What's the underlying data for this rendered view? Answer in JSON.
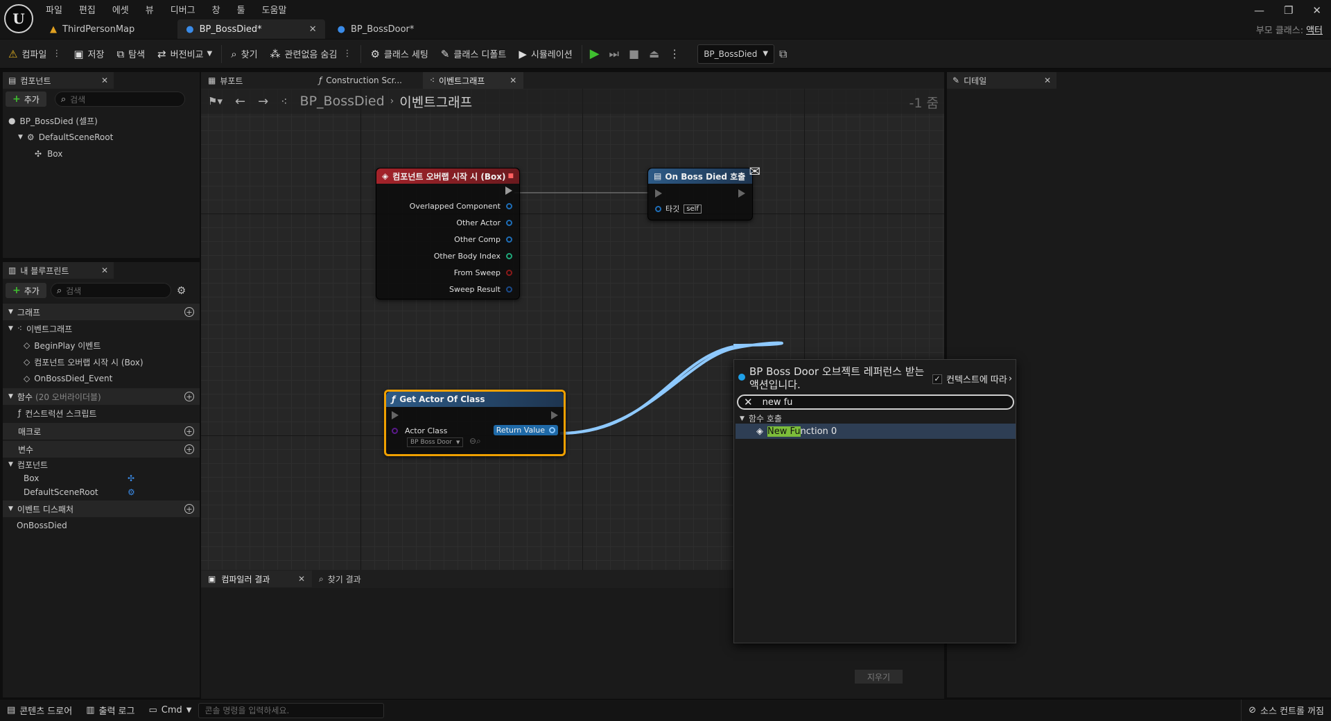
{
  "menu": [
    "파일",
    "편집",
    "에셋",
    "뷰",
    "디버그",
    "창",
    "툴",
    "도움말"
  ],
  "doc_tabs": [
    {
      "label": "ThirdPersonMap"
    },
    {
      "label": "BP_BossDied*"
    },
    {
      "label": "BP_BossDoor*"
    }
  ],
  "parent_class": {
    "label": "부모 클래스:",
    "value": "액터"
  },
  "toolbar": {
    "compile": "컴파일",
    "save": "저장",
    "browse": "탐색",
    "diff": "버전비교",
    "find": "찾기",
    "hide_unrelated": "관련없음 숨김",
    "class_settings": "클래스 세팅",
    "class_defaults": "클래스 디폴트",
    "simulation": "시뮬레이션",
    "debug_object": "BP_BossDied"
  },
  "components_panel": {
    "title": "컴포넌트",
    "add": "추가",
    "search_placeholder": "검색",
    "tree": [
      "BP_BossDied (셀프)",
      "DefaultSceneRoot",
      "Box"
    ]
  },
  "my_blueprint": {
    "title": "내 블루프린트",
    "add": "추가",
    "search_placeholder": "검색",
    "graphs_label": "그래프",
    "event_graph": "이벤트그래프",
    "events": [
      "BeginPlay 이벤트",
      "컴포넌트 오버랩 시작 시 (Box)",
      "OnBossDied_Event"
    ],
    "functions_label": "함수",
    "functions_sub": "(20 오버라이더블)",
    "construction_script": "컨스트럭션 스크립트",
    "macros_label": "매크로",
    "variables_label": "변수",
    "components_label": "컴포넌트",
    "variables": [
      "Box",
      "DefaultSceneRoot"
    ],
    "dispatchers_label": "이벤트 디스패처",
    "dispatchers": [
      "OnBossDied"
    ]
  },
  "editor_tabs": [
    {
      "label": "뷰포트"
    },
    {
      "label": "Construction Scr..."
    },
    {
      "label": "이벤트그래프"
    }
  ],
  "breadcrumb": {
    "root": "BP_BossDied",
    "current": "이벤트그래프",
    "zoom": "-1 줌"
  },
  "nodes": {
    "overlap": {
      "title": "컴포넌트 오버랩 시작 시 (Box)",
      "pins": [
        "Overlapped Component",
        "Other Actor",
        "Other Comp",
        "Other Body Index",
        "From Sweep",
        "Sweep Result"
      ]
    },
    "call": {
      "title": "On Boss Died 호출",
      "target_label": "타깃",
      "target_value": "self"
    },
    "get_actor": {
      "title": "Get Actor Of Class",
      "actor_class": "Actor Class",
      "class_value": "BP Boss Door",
      "return_value": "Return Value"
    }
  },
  "context_menu": {
    "title": "BP Boss Door 오브젝트 레퍼런스 받는 액션입니다.",
    "context_sensitive": "컨텍스트에 따라",
    "search_value": "new fu",
    "category": "함수 호출",
    "item_match": "New Fu",
    "item_rest": "nction 0"
  },
  "details_panel": {
    "title": "디테일"
  },
  "bottom_tabs": {
    "compiler_results": "컴파일러 결과",
    "find_results": "찾기 결과",
    "clear": "지우기"
  },
  "statusbar": {
    "content_drawer": "콘텐츠 드로어",
    "output_log": "출력 로그",
    "cmd": "Cmd",
    "console_placeholder": "콘솔 명령을 입력하세요.",
    "source_control": "소스 컨트롤 꺼짐"
  },
  "colors": {
    "accent_blue": "#1fa0e8",
    "play_green": "#3fbf2f",
    "event_red": "#a4232a",
    "function_blue": "#2d5a86",
    "select_orange": "#f0a000"
  }
}
